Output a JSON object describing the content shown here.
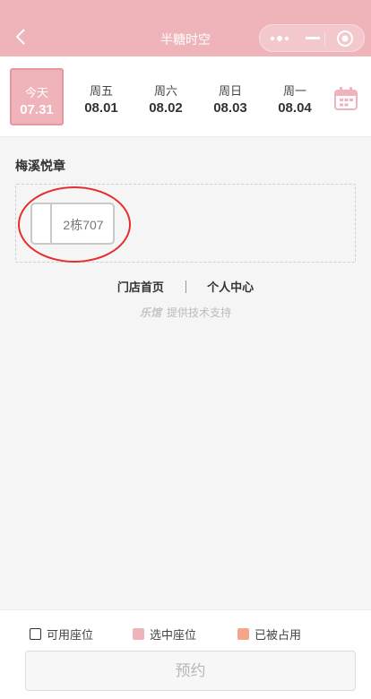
{
  "navbar": {
    "title": "半糖时空"
  },
  "dates": [
    {
      "weekday": "今天",
      "date": "07.31",
      "active": true
    },
    {
      "weekday": "周五",
      "date": "08.01",
      "active": false
    },
    {
      "weekday": "周六",
      "date": "08.02",
      "active": false
    },
    {
      "weekday": "周日",
      "date": "08.03",
      "active": false
    },
    {
      "weekday": "周一",
      "date": "08.04",
      "active": false
    }
  ],
  "venue": {
    "name": "梅溪悦章",
    "seat_label": "2栋707"
  },
  "footer": {
    "home_link": "门店首页",
    "profile_link": "个人中心",
    "brand_logo": "乐馆",
    "brand_text": "提供技术支持"
  },
  "legend": {
    "available": "可用座位",
    "selected": "选中座位",
    "occupied": "已被占用"
  },
  "colors": {
    "accent": "#efb3ba",
    "selected": "#efb3ba",
    "occupied": "#f5a58a",
    "highlight": "#e62d2d"
  },
  "book_button": "预约"
}
